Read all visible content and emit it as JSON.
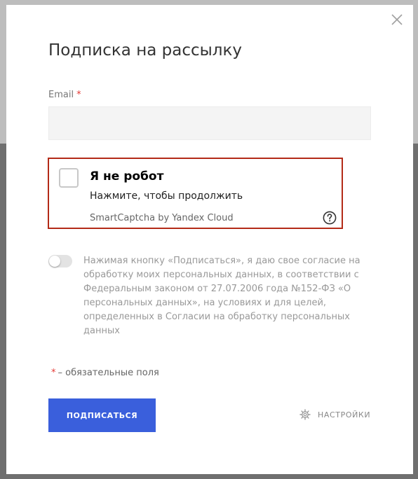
{
  "modal": {
    "title": "Подписка на рассылку",
    "close_icon": "close-icon"
  },
  "email": {
    "label": "Email",
    "required_mark": "*",
    "value": "",
    "placeholder": ""
  },
  "captcha": {
    "title": "Я не робот",
    "subtitle": "Нажмите, чтобы продолжить",
    "brand": "SmartCaptcha by Yandex Cloud",
    "checked": false,
    "help_icon": "question-circle-icon",
    "border_color": "#b32a17"
  },
  "consent": {
    "enabled": false,
    "text": "Нажимая кнопку «Подписаться», я даю свое согласие на обработку моих персональных данных, в соответствии с Федеральным законом от 27.07.2006 года №152-ФЗ «О персональных данных», на условиях и для целей, определенных в Согласии на обработку персональных данных"
  },
  "required_note": {
    "mark": "*",
    "text": "– обязательные поля"
  },
  "actions": {
    "subscribe_label": "ПОДПИСАТЬСЯ",
    "settings_label": "НАСТРОЙКИ",
    "settings_icon": "gear-icon"
  },
  "colors": {
    "primary": "#3a5fdc",
    "required": "#e53935",
    "captcha_border": "#b32a17"
  }
}
